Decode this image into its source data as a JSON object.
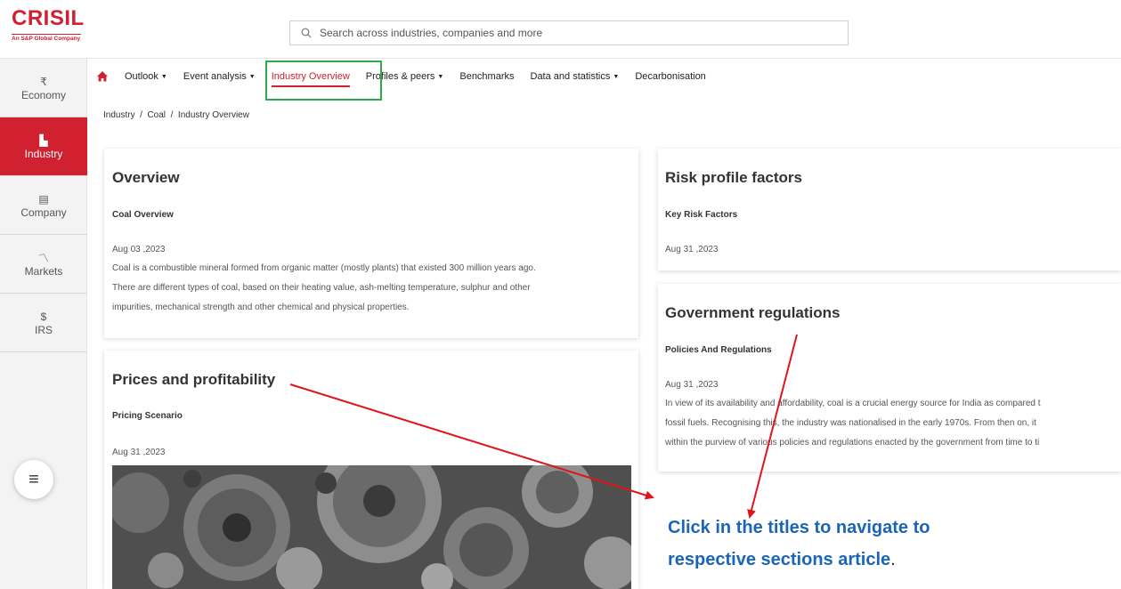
{
  "logo": {
    "word": "CRISIL",
    "tagline": "An S&P Global Company"
  },
  "search": {
    "placeholder": "Search across industries, companies and more"
  },
  "sidebar": {
    "items": [
      {
        "icon": "₹",
        "icon_name": "rupee-icon",
        "label": "Economy"
      },
      {
        "icon": "▙",
        "icon_name": "factory-icon",
        "label": "Industry",
        "active": true
      },
      {
        "icon": "▤",
        "icon_name": "building-icon",
        "label": "Company"
      },
      {
        "icon": "〽",
        "icon_name": "chart-line-icon",
        "label": "Markets"
      },
      {
        "icon": "$",
        "icon_name": "dollar-icon",
        "label": "IRS"
      }
    ],
    "menu_icon": "≡"
  },
  "nav": {
    "items": [
      {
        "label": "Outlook",
        "dropdown": true
      },
      {
        "label": "Event analysis",
        "dropdown": true
      },
      {
        "label": "Industry Overview",
        "active": true
      },
      {
        "label": "Profiles & peers",
        "dropdown": true
      },
      {
        "label": "Benchmarks"
      },
      {
        "label": "Data and statistics",
        "dropdown": true
      },
      {
        "label": "Decarbonisation"
      }
    ],
    "accent": "#d1202f"
  },
  "breadcrumb": {
    "text": "Industry  /  Coal  /  Industry Overview"
  },
  "cards": {
    "overview": {
      "title": "Overview",
      "subtitle": "Coal Overview",
      "date": "Aug 03 ,2023",
      "lines": [
        "Coal is a combustible mineral formed from organic matter (mostly plants) that existed 300 million years ago.",
        "There are different types of coal, based on their heating value, ash-melting temperature, sulphur and other",
        "impurities, mechanical strength and other chemical and physical properties."
      ]
    },
    "prices": {
      "title": "Prices and profitability",
      "subtitle": "Pricing Scenario",
      "date": "Aug 31 ,2023"
    },
    "risk": {
      "title": "Risk profile factors",
      "subtitle": "Key Risk Factors",
      "date": "Aug 31 ,2023"
    },
    "government": {
      "title": "Government regulations",
      "subtitle": "Policies And Regulations",
      "date": "Aug 31 ,2023",
      "lines": [
        "In view of its availability and affordability, coal is a crucial energy source for India as compared t",
        "fossil fuels. Recognising this, the industry was nationalised in the early 1970s. From then on, it",
        "within the purview of various policies and regulations enacted by the government from time to ti"
      ]
    }
  },
  "annotation": {
    "line1": "Click in the titles to navigate to",
    "line2": "respective sections article",
    "line2_end": ".",
    "color": "#1b65b8",
    "arrow_color": "#e0141b"
  }
}
